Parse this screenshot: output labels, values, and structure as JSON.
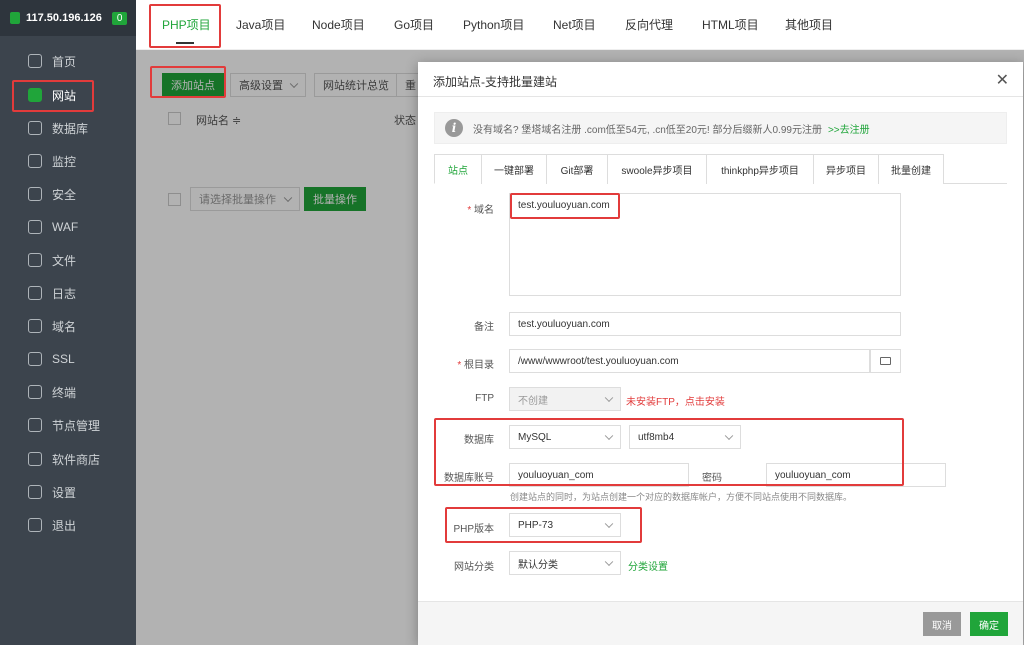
{
  "server": {
    "ip": "117.50.196.126",
    "badge": "0"
  },
  "sidebar": {
    "items": [
      {
        "label": "首页",
        "icon": "home-icon"
      },
      {
        "label": "网站",
        "icon": "globe-icon"
      },
      {
        "label": "数据库",
        "icon": "database-icon"
      },
      {
        "label": "监控",
        "icon": "monitor-icon"
      },
      {
        "label": "安全",
        "icon": "shield-icon"
      },
      {
        "label": "WAF",
        "icon": "firewall-icon"
      },
      {
        "label": "文件",
        "icon": "folder-icon"
      },
      {
        "label": "日志",
        "icon": "log-icon"
      },
      {
        "label": "域名",
        "icon": "domain-icon"
      },
      {
        "label": "SSL",
        "icon": "ssl-icon"
      },
      {
        "label": "终端",
        "icon": "terminal-icon"
      },
      {
        "label": "节点管理",
        "icon": "node-icon"
      },
      {
        "label": "软件商店",
        "icon": "store-icon"
      },
      {
        "label": "设置",
        "icon": "gear-icon"
      },
      {
        "label": "退出",
        "icon": "logout-icon"
      }
    ],
    "active_index": 1
  },
  "tabs": [
    "PHP项目",
    "Java项目",
    "Node项目",
    "Go项目",
    "Python项目",
    "Net项目",
    "反向代理",
    "HTML项目",
    "其他项目"
  ],
  "toolbar": {
    "add_site": "添加站点",
    "advanced": "高级设置",
    "stats": "网站统计总览",
    "more": "重"
  },
  "table": {
    "col_name": "网站名 ≑",
    "col_status": "状态"
  },
  "batch": {
    "select_placeholder": "请选择批量操作",
    "apply": "批量操作"
  },
  "dialog": {
    "title": "添加站点-支持批量建站",
    "close": "✕",
    "notice": "没有域名? 堡塔域名注册 .com低至54元, .cn低至20元! 部分后缀新人0.99元注册",
    "notice_link": ">>去注册",
    "tabs": [
      "站点",
      "一键部署",
      "Git部署",
      "swoole异步项目",
      "thinkphp异步项目",
      "异步项目",
      "批量创建"
    ],
    "active_tab": 0,
    "domain_label": "域名",
    "domain_value": "test.youluoyuan.com",
    "remark_label": "备注",
    "remark_value": "test.youluoyuan.com",
    "root_label": "根目录",
    "root_value": "/www/wwwroot/test.youluoyuan.com",
    "ftp_label": "FTP",
    "ftp_value": "不创建",
    "ftp_warn": "未安装FTP，点击安装",
    "db_label": "数据库",
    "db_type": "MySQL",
    "db_charset": "utf8mb4",
    "db_user_label": "数据库账号",
    "db_user": "youluoyuan_com",
    "db_pwd_label": "密码",
    "db_pwd": "youluoyuan_com",
    "db_help": "创建站点的同时，为站点创建一个对应的数据库帐户，方便不同站点使用不同数据库。",
    "php_label": "PHP版本",
    "php_value": "PHP-73",
    "category_label": "网站分类",
    "category_value": "默认分类",
    "category_link": "分类设置",
    "cancel": "取消",
    "confirm": "确定"
  },
  "colors": {
    "accent": "#20a53a",
    "highlight": "#e23b3b",
    "sidebar": "#3c444d"
  }
}
